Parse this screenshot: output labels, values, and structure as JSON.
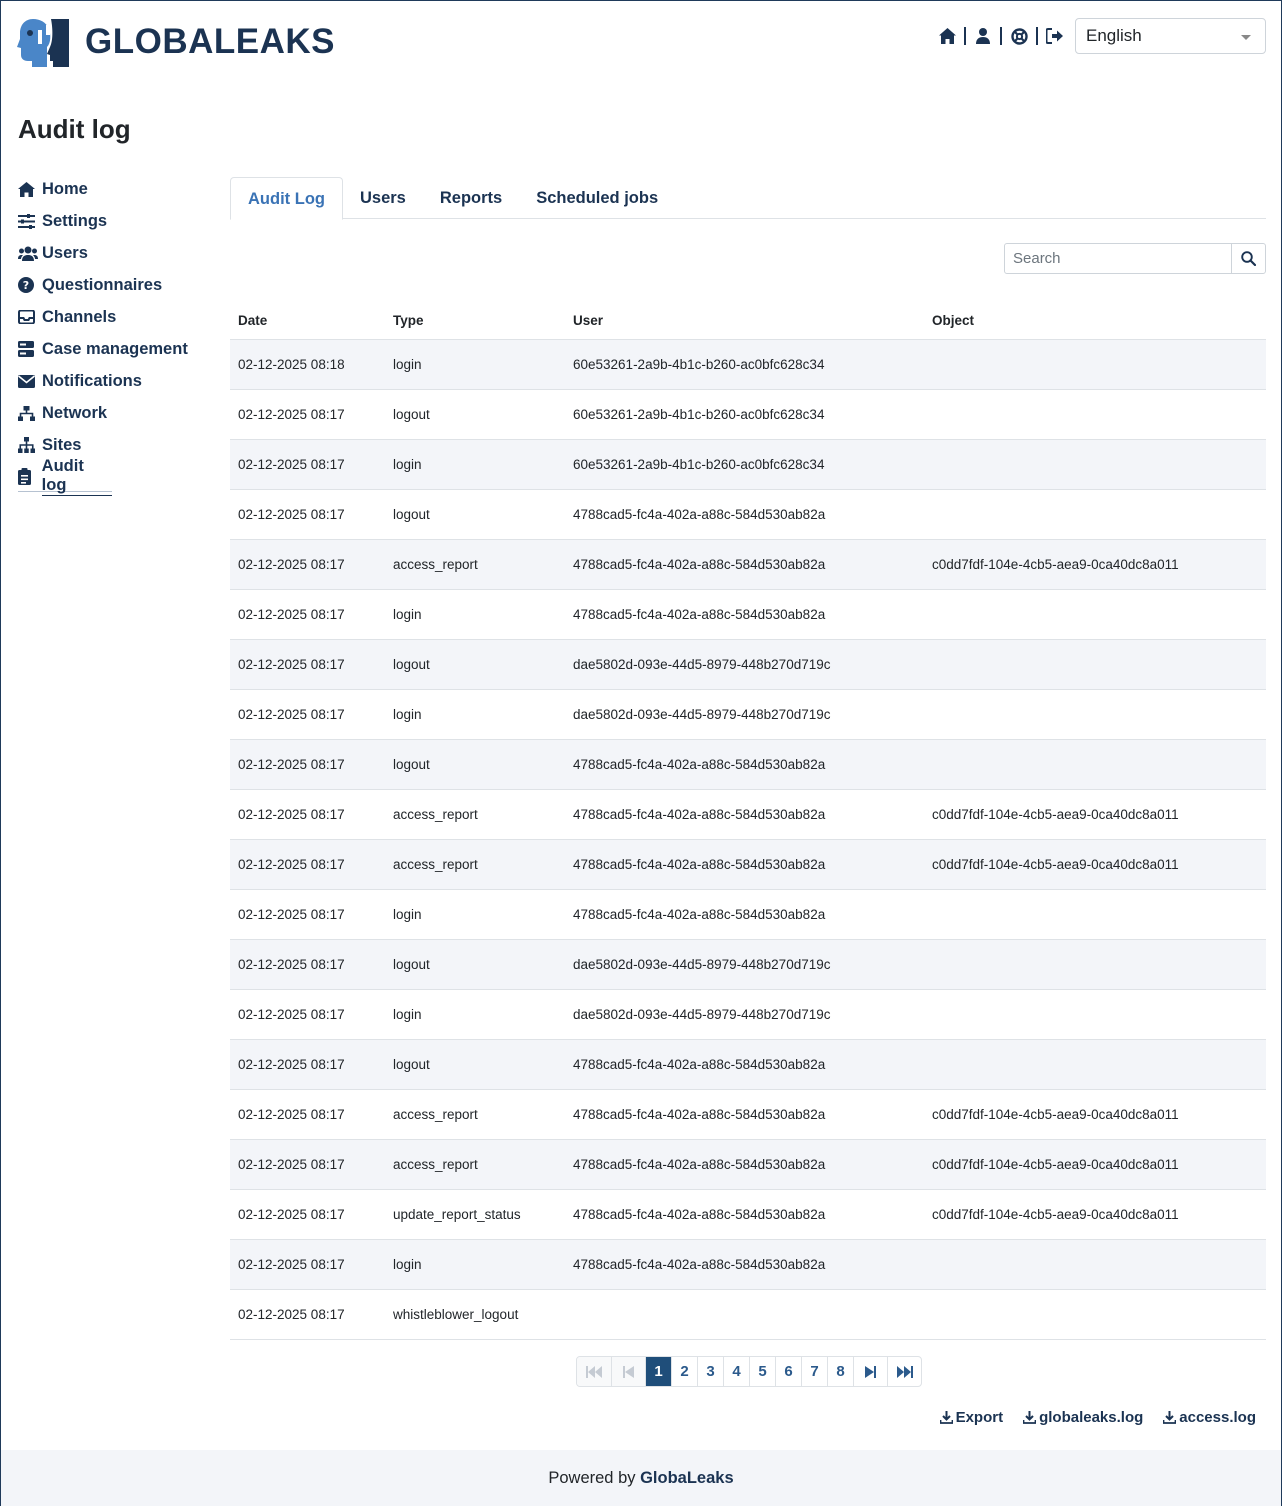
{
  "app": {
    "brand": "GLOBALEAKS"
  },
  "header": {
    "icons": [
      "home-icon",
      "user-icon",
      "help-icon",
      "sign-out-icon"
    ],
    "language": "English"
  },
  "page": {
    "title": "Audit log"
  },
  "sidebar": {
    "items": [
      {
        "label": "Home",
        "icon": "home-icon"
      },
      {
        "label": "Settings",
        "icon": "sliders-icon"
      },
      {
        "label": "Users",
        "icon": "users-icon"
      },
      {
        "label": "Questionnaires",
        "icon": "question-icon"
      },
      {
        "label": "Channels",
        "icon": "inbox-icon"
      },
      {
        "label": "Case management",
        "icon": "server-icon"
      },
      {
        "label": "Notifications",
        "icon": "envelope-icon"
      },
      {
        "label": "Network",
        "icon": "network-icon"
      },
      {
        "label": "Sites",
        "icon": "sitemap-icon"
      },
      {
        "label": "Audit log",
        "icon": "clipboard-icon"
      }
    ],
    "active": "Audit log"
  },
  "tabs": [
    "Audit Log",
    "Users",
    "Reports",
    "Scheduled jobs"
  ],
  "search": {
    "placeholder": "Search"
  },
  "table": {
    "columns": [
      "Date",
      "Type",
      "User",
      "Object"
    ],
    "rows": [
      [
        "02-12-2025 08:18",
        "login",
        "60e53261-2a9b-4b1c-b260-ac0bfc628c34",
        ""
      ],
      [
        "02-12-2025 08:17",
        "logout",
        "60e53261-2a9b-4b1c-b260-ac0bfc628c34",
        ""
      ],
      [
        "02-12-2025 08:17",
        "login",
        "60e53261-2a9b-4b1c-b260-ac0bfc628c34",
        ""
      ],
      [
        "02-12-2025 08:17",
        "logout",
        "4788cad5-fc4a-402a-a88c-584d530ab82a",
        ""
      ],
      [
        "02-12-2025 08:17",
        "access_report",
        "4788cad5-fc4a-402a-a88c-584d530ab82a",
        "c0dd7fdf-104e-4cb5-aea9-0ca40dc8a011"
      ],
      [
        "02-12-2025 08:17",
        "login",
        "4788cad5-fc4a-402a-a88c-584d530ab82a",
        ""
      ],
      [
        "02-12-2025 08:17",
        "logout",
        "dae5802d-093e-44d5-8979-448b270d719c",
        ""
      ],
      [
        "02-12-2025 08:17",
        "login",
        "dae5802d-093e-44d5-8979-448b270d719c",
        ""
      ],
      [
        "02-12-2025 08:17",
        "logout",
        "4788cad5-fc4a-402a-a88c-584d530ab82a",
        ""
      ],
      [
        "02-12-2025 08:17",
        "access_report",
        "4788cad5-fc4a-402a-a88c-584d530ab82a",
        "c0dd7fdf-104e-4cb5-aea9-0ca40dc8a011"
      ],
      [
        "02-12-2025 08:17",
        "access_report",
        "4788cad5-fc4a-402a-a88c-584d530ab82a",
        "c0dd7fdf-104e-4cb5-aea9-0ca40dc8a011"
      ],
      [
        "02-12-2025 08:17",
        "login",
        "4788cad5-fc4a-402a-a88c-584d530ab82a",
        ""
      ],
      [
        "02-12-2025 08:17",
        "logout",
        "dae5802d-093e-44d5-8979-448b270d719c",
        ""
      ],
      [
        "02-12-2025 08:17",
        "login",
        "dae5802d-093e-44d5-8979-448b270d719c",
        ""
      ],
      [
        "02-12-2025 08:17",
        "logout",
        "4788cad5-fc4a-402a-a88c-584d530ab82a",
        ""
      ],
      [
        "02-12-2025 08:17",
        "access_report",
        "4788cad5-fc4a-402a-a88c-584d530ab82a",
        "c0dd7fdf-104e-4cb5-aea9-0ca40dc8a011"
      ],
      [
        "02-12-2025 08:17",
        "access_report",
        "4788cad5-fc4a-402a-a88c-584d530ab82a",
        "c0dd7fdf-104e-4cb5-aea9-0ca40dc8a011"
      ],
      [
        "02-12-2025 08:17",
        "update_report_status",
        "4788cad5-fc4a-402a-a88c-584d530ab82a",
        "c0dd7fdf-104e-4cb5-aea9-0ca40dc8a011"
      ],
      [
        "02-12-2025 08:17",
        "login",
        "4788cad5-fc4a-402a-a88c-584d530ab82a",
        ""
      ],
      [
        "02-12-2025 08:17",
        "whistleblower_logout",
        "",
        ""
      ]
    ]
  },
  "pagination": {
    "pages": [
      "1",
      "2",
      "3",
      "4",
      "5",
      "6",
      "7",
      "8"
    ],
    "current": "1"
  },
  "downloads": [
    "Export",
    "globaleaks.log",
    "access.log"
  ],
  "footer": {
    "prefix": "Powered by",
    "brand": "GlobaLeaks"
  },
  "colors": {
    "brand": "#1b3352",
    "accent": "#3a73b5",
    "active_page": "#1f4e7a"
  }
}
